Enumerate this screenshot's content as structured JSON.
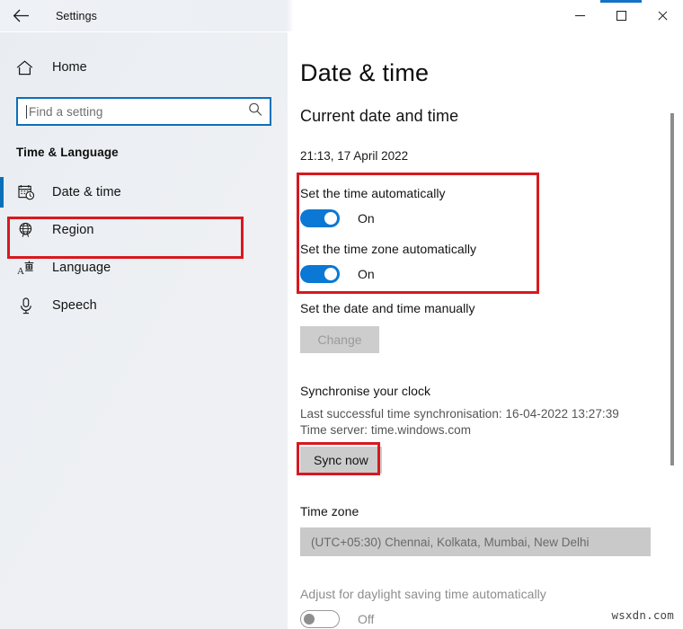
{
  "window": {
    "title": "Settings",
    "back_icon": "back-arrow-icon",
    "minimize_label": "—",
    "maximize_label": "□",
    "close_label": "✕"
  },
  "sidebar": {
    "home_label": "Home",
    "home_icon": "home-icon",
    "search": {
      "placeholder": "Find a setting",
      "value": "",
      "icon": "search-icon"
    },
    "group_title": "Time & Language",
    "items": [
      {
        "label": "Date & time",
        "icon": "calendar-clock-icon",
        "selected": true
      },
      {
        "label": "Region",
        "icon": "globe-icon",
        "selected": false
      },
      {
        "label": "Language",
        "icon": "language-icon",
        "selected": false
      },
      {
        "label": "Speech",
        "icon": "microphone-icon",
        "selected": false
      }
    ]
  },
  "main": {
    "page_title": "Date & time",
    "current_section_title": "Current date and time",
    "current_datetime": "21:13, 17 April 2022",
    "set_time_auto": {
      "label": "Set the time automatically",
      "state": "On",
      "on": true
    },
    "set_timezone_auto": {
      "label": "Set the time zone automatically",
      "state": "On",
      "on": true
    },
    "manual": {
      "label": "Set the date and time manually",
      "button_label": "Change",
      "button_disabled": true
    },
    "sync": {
      "section_title": "Synchronise your clock",
      "last_sync": "Last successful time synchronisation: 16-04-2022 13:27:39",
      "time_server": "Time server: time.windows.com",
      "button_label": "Sync now"
    },
    "timezone": {
      "section_title": "Time zone",
      "value": "(UTC+05:30) Chennai, Kolkata, Mumbai, New Delhi"
    },
    "dst": {
      "label": "Adjust for daylight saving time automatically",
      "state": "Off",
      "on": false
    }
  },
  "annotations": {
    "highlight_color": "#d71920",
    "accent_color": "#0a70b9",
    "toggle_on_color": "#0a78d4"
  },
  "watermark": "wsxdn.com"
}
